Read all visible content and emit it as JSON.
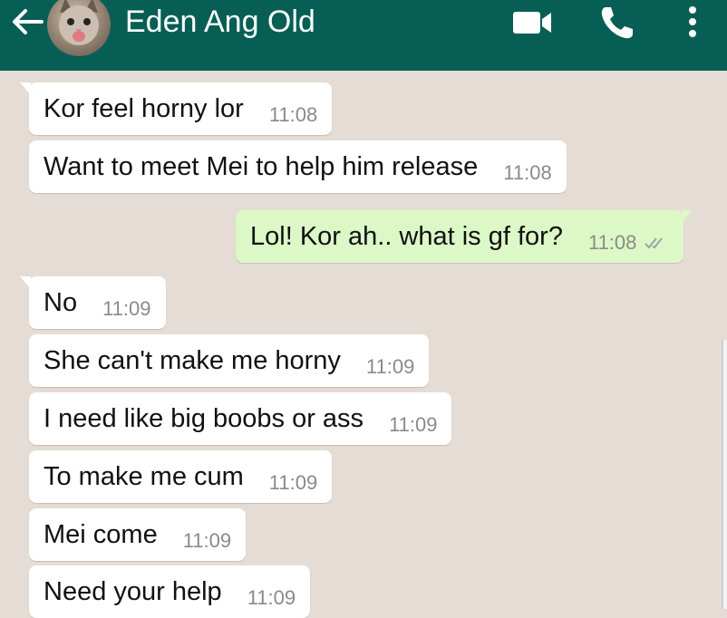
{
  "header": {
    "contact_name": "Eden Ang Old",
    "icons": [
      "back-arrow-icon",
      "avatar",
      "video-call-icon",
      "phone-icon",
      "more-icon"
    ]
  },
  "messages": [
    {
      "direction": "in",
      "text": "Kor feel horny lor",
      "time": "11:08"
    },
    {
      "direction": "in",
      "text": "Want to meet Mei to help him release",
      "time": "11:08"
    },
    {
      "direction": "out",
      "text": "Lol! Kor ah.. what is gf for?",
      "time": "11:08",
      "status": "read-double-check"
    },
    {
      "direction": "in",
      "text": "No",
      "time": "11:09"
    },
    {
      "direction": "in",
      "text": "She can't make me horny",
      "time": "11:09"
    },
    {
      "direction": "in",
      "text": "I need like big boobs or ass",
      "time": "11:09"
    },
    {
      "direction": "in",
      "text": "To make me cum",
      "time": "11:09"
    },
    {
      "direction": "in",
      "text": "Mei come",
      "time": "11:09"
    },
    {
      "direction": "in",
      "text": "Need your help",
      "time": "11:09"
    }
  ],
  "colors": {
    "header": "#075e54",
    "chat_bg": "#e5ddd5",
    "incoming": "#ffffff",
    "outgoing": "#dcf8c6"
  }
}
